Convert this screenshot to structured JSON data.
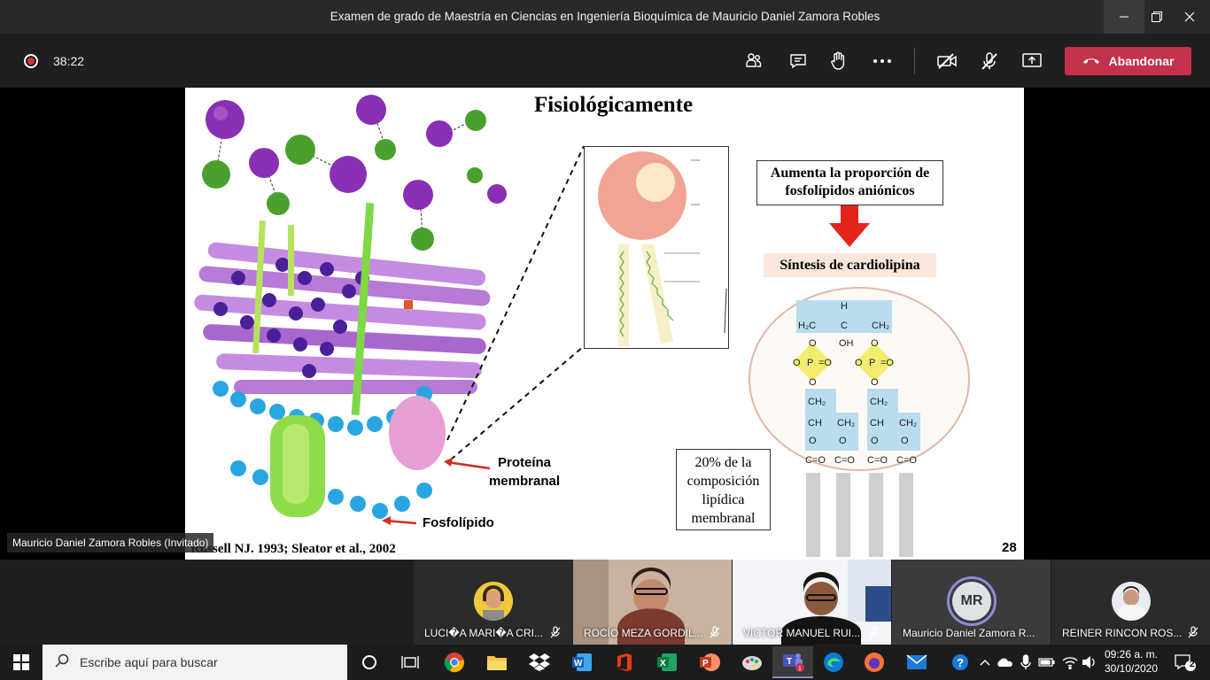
{
  "window": {
    "title": "Examen de grado de Maestría en Ciencias en Ingeniería Bioquímica de Mauricio Daniel Zamora Robles"
  },
  "meeting": {
    "timer": "38:22",
    "leave_label": "Abandonar"
  },
  "slide": {
    "title": "Fisiológicamente",
    "callout_top": "Aumenta la proporción de fosfolípidos aniónicos",
    "callout_synthesis": "Síntesis de cardiolipina",
    "composition_note": "20% de la composición lipídica membranal",
    "label_protein": "Proteína membranal",
    "label_phospholipid": "Fosfolípido",
    "citation": "Russell NJ. 1993; Sleator et al., 2002",
    "page_number": "28"
  },
  "presenter_label": "Mauricio Daniel Zamora Robles (Invitado)",
  "participants": [
    {
      "name": "LUCI�A MARI�A CRI..."
    },
    {
      "name": "ROCÍO MEZA GORDIL..."
    },
    {
      "name": "VICTOR MANUEL RUI..."
    },
    {
      "name": "Mauricio Daniel Zamora R...",
      "initials": "MR"
    },
    {
      "name": "REINER RINCON ROS..."
    }
  ],
  "taskbar": {
    "search_placeholder": "Escribe aquí para buscar",
    "time": "09:26 a. m.",
    "date": "30/10/2020",
    "notification_count": "2"
  },
  "colors": {
    "hangup": "#c4314b",
    "titlebar": "#292929",
    "toolbar": "#1f1f1f"
  }
}
